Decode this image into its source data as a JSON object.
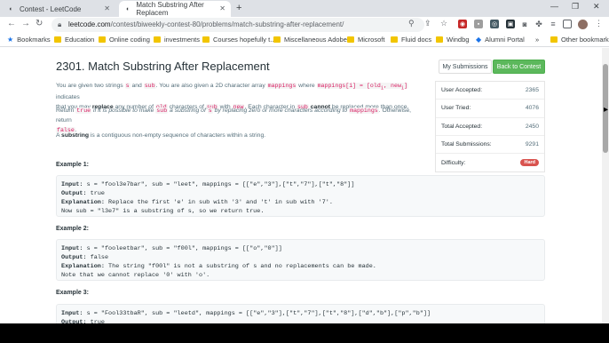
{
  "browser": {
    "tabs": [
      {
        "title": "Contest - LeetCode",
        "active": false
      },
      {
        "title": "Match Substring After Replacem",
        "active": true
      }
    ],
    "url_host": "leetcode.com",
    "url_path": "/contest/biweekly-contest-80/problems/match-substring-after-replacement/",
    "bookmarks": [
      {
        "label": "Bookmarks",
        "icon": "star-icon"
      },
      {
        "label": "Education",
        "icon": "folder-icon"
      },
      {
        "label": "Online coding",
        "icon": "folder-icon"
      },
      {
        "label": "investments",
        "icon": "folder-icon"
      },
      {
        "label": "Courses hopefully t...",
        "icon": "folder-icon"
      },
      {
        "label": "Miscellaneous Adobe",
        "icon": "folder-icon"
      },
      {
        "label": "Microsoft",
        "icon": "folder-icon"
      },
      {
        "label": "Fluid docs",
        "icon": "folder-icon"
      },
      {
        "label": "Windbg",
        "icon": "folder-icon"
      },
      {
        "label": "Alumni Portal",
        "icon": "alumni-icon"
      },
      {
        "label": "Other bookmarks",
        "icon": "folder-icon"
      }
    ],
    "overflow": "»"
  },
  "problem": {
    "title": "2301. Match Substring After Replacement",
    "p1": {
      "a": "You are given two strings ",
      "s": "s",
      "b": " and ",
      "sub": "sub",
      "c": ". You are also given a 2D character array ",
      "mappings": "mappings",
      "d": " where ",
      "mapping_i": "mappings[i] = [old",
      "old_sub": "i",
      "mid": ", new",
      "new_sub": "i",
      "close": "]",
      "e": " indicates",
      "line2a": "that you may ",
      "replace": "replace",
      "line2b": " any number of ",
      "old": "old",
      "line2c": " characters of ",
      "sub2": "sub",
      "line2d": " with ",
      "new": "new",
      "line2e": ". Each character in ",
      "sub3": "sub",
      "line2f": " ",
      "cannot": "cannot",
      "line2g": " be replaced more than once."
    },
    "p2": {
      "a": "Return ",
      "true": "true",
      "b": " if it is possible to make ",
      "sub": "sub",
      "c": " a substring of ",
      "s": "s",
      "d": " by replacing zero or more characters according to ",
      "mappings": "mappings",
      "e": ". Otherwise, return",
      "false": "false",
      "f": "."
    },
    "p3": {
      "a": "A ",
      "substring": "substring",
      "b": " is a contiguous non-empty sequence of characters within a string."
    },
    "examples": [
      {
        "heading": "Example 1:",
        "input": "s = \"fool3e7bar\", sub = \"leet\", mappings = [[\"e\",\"3\"],[\"t\",\"7\"],[\"t\",\"8\"]]",
        "output": "true",
        "explanation": "Replace the first 'e' in sub with '3' and 't' in sub with '7'.",
        "extra": "Now sub = \"l3e7\" is a substring of s, so we return true."
      },
      {
        "heading": "Example 2:",
        "input": "s = \"fooleetbar\", sub = \"f00l\", mappings = [[\"o\",\"0\"]]",
        "output": "false",
        "explanation": "The string \"f00l\" is not a substring of s and no replacements can be made.",
        "extra": "Note that we cannot replace '0' with 'o'."
      },
      {
        "heading": "Example 3:",
        "input": "s = \"Fool33tbaR\", sub = \"leetd\", mappings = [[\"e\",\"3\"],[\"t\",\"7\"],[\"t\",\"8\"],[\"d\",\"b\"],[\"p\",\"b\"]]",
        "output": "true"
      }
    ],
    "labels": {
      "input": "Input:",
      "output": "Output:",
      "explanation": "Explanation:"
    }
  },
  "sidebar": {
    "my_submissions": "My Submissions",
    "back_to_contest": "Back to Contest",
    "stats": [
      {
        "label": "User Accepted:",
        "value": "2365"
      },
      {
        "label": "User Tried:",
        "value": "4076"
      },
      {
        "label": "Total Accepted:",
        "value": "2450"
      },
      {
        "label": "Total Submissions:",
        "value": "9291"
      }
    ],
    "difficulty_label": "Difficulty:",
    "difficulty": "Hard",
    "difficulty_color": "#d9534f",
    "accent_color": "#5cb85c"
  }
}
